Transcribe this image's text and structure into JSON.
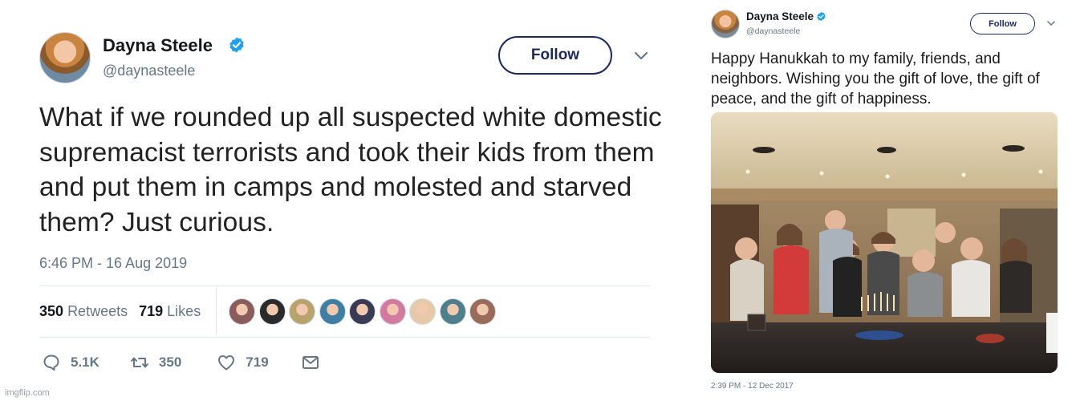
{
  "left_tweet": {
    "name": "Dayna Steele",
    "handle": "@daynasteele",
    "follow_label": "Follow",
    "text": "What if we rounded up all suspected white domestic supremacist terrorists and took their kids from them and put them in camps and molested and starved them? Just curious.",
    "timestamp": "6:46 PM - 16 Aug 2019",
    "retweets_count": "350",
    "retweets_label": "Retweets",
    "likes_count": "719",
    "likes_label": "Likes",
    "actions": {
      "reply_count": "5.1K",
      "retweet_count": "350",
      "like_count": "719"
    },
    "liker_avatars": [
      {
        "name": "liker-avatar",
        "color": "#8a5c5c"
      },
      {
        "name": "liker-avatar",
        "color": "#2b2b2b"
      },
      {
        "name": "liker-avatar",
        "color": "#b9a36d"
      },
      {
        "name": "liker-avatar",
        "color": "#3f7fa3"
      },
      {
        "name": "liker-avatar",
        "color": "#3a3a55"
      },
      {
        "name": "liker-avatar",
        "color": "#d27aa0"
      },
      {
        "name": "liker-avatar",
        "color": "#e6c9a8"
      },
      {
        "name": "liker-avatar",
        "color": "#4d7f8c"
      },
      {
        "name": "liker-avatar",
        "color": "#9a6b5a"
      }
    ]
  },
  "right_tweet": {
    "name": "Dayna Steele",
    "handle": "@daynasteele",
    "follow_label": "Follow",
    "text": "Happy Hanukkah to my family, friends, and neighbors. Wishing you the gift of love, the gift of peace, and the gift of happiness.",
    "timestamp": "2:39 PM - 12 Dec 2017"
  },
  "watermark": "imgflip.com",
  "colors": {
    "verified": "#1da1f2",
    "follow_border": "#1b2a5e",
    "secondary_text": "#657786",
    "divider": "#e1e8ed"
  },
  "icons": [
    "verified-badge-icon",
    "chevron-down-icon",
    "reply-icon",
    "retweet-icon",
    "like-icon",
    "direct-message-icon"
  ]
}
